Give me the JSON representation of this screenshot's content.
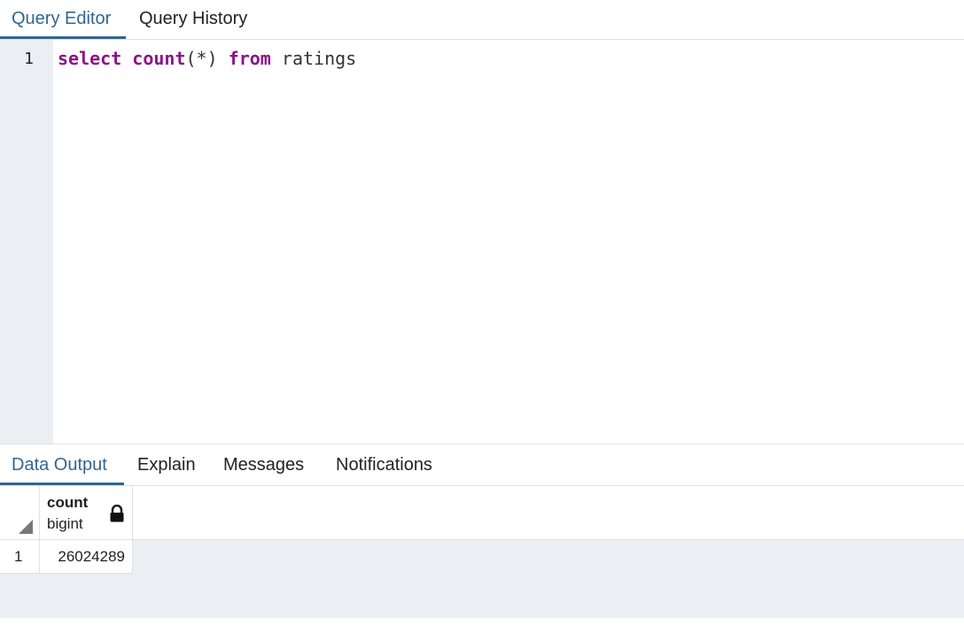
{
  "top_tabs": [
    {
      "label": "Query Editor",
      "active": true
    },
    {
      "label": "Query History",
      "active": false
    }
  ],
  "editor": {
    "line_number": "1",
    "tokens": {
      "select": "select",
      "count": "count",
      "paren": "(*)",
      "from": "from",
      "table": "ratings"
    }
  },
  "bottom_tabs": [
    {
      "label": "Data Output",
      "active": true
    },
    {
      "label": "Explain",
      "active": false
    },
    {
      "label": "Messages",
      "active": false
    },
    {
      "label": "Notifications",
      "active": false
    }
  ],
  "grid": {
    "columns": [
      {
        "name": "count",
        "type": "bigint",
        "icon": "lock-icon"
      }
    ],
    "rows": [
      {
        "row_number": "1",
        "values": [
          "26024289"
        ]
      }
    ]
  },
  "colors": {
    "accent": "#326690",
    "keyword": "#8b138b",
    "gutter": "#ebeef3"
  }
}
